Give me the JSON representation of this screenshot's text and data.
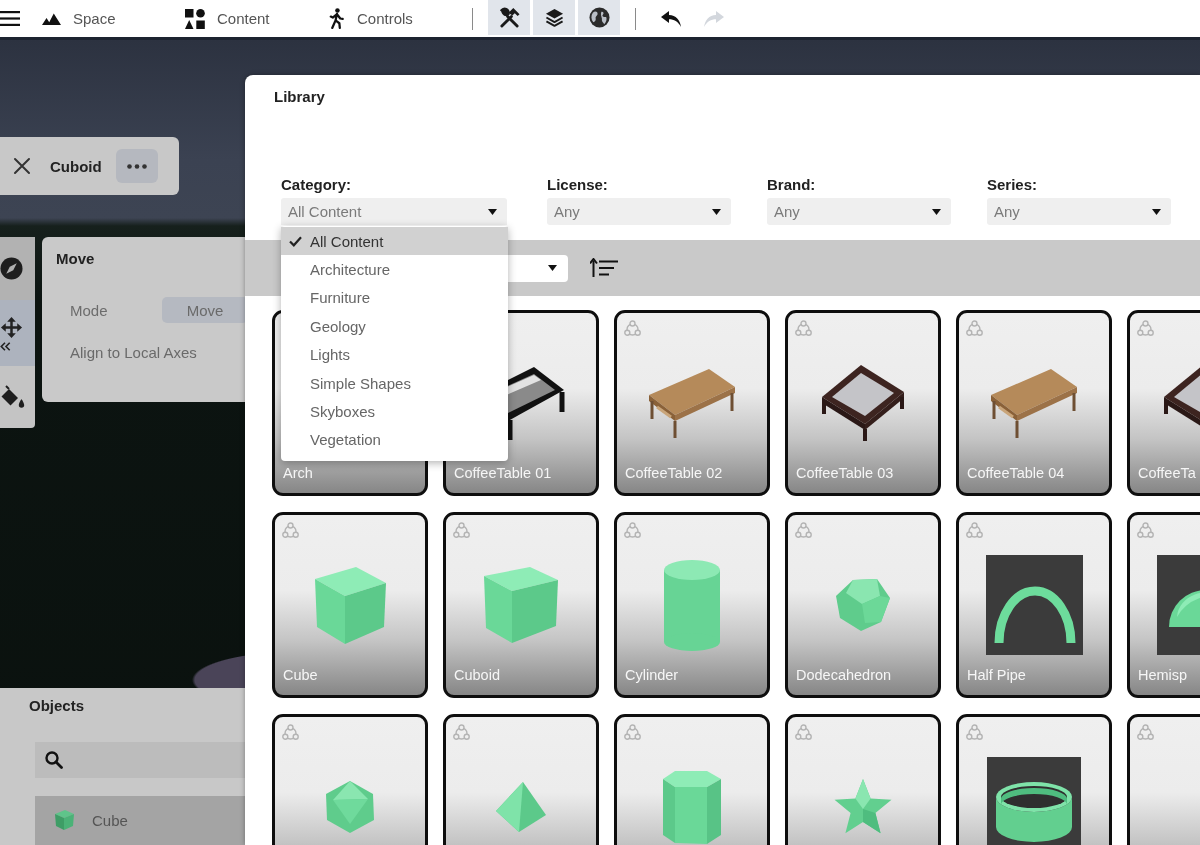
{
  "toolbar": {
    "tabs": [
      {
        "label": "Space"
      },
      {
        "label": "Content"
      },
      {
        "label": "Controls"
      }
    ],
    "view_toggles": [
      {
        "on": true
      },
      {
        "on": true
      },
      {
        "on": true
      }
    ],
    "history": [
      {
        "disabled": false
      },
      {
        "disabled": true
      }
    ]
  },
  "selection_panel": {
    "title": "Cuboid"
  },
  "tool_rail": [
    {
      "selected": false
    },
    {
      "selected": true
    },
    {
      "selected": false
    }
  ],
  "move_panel": {
    "title": "Move",
    "mode_label": "Mode",
    "mode_value": "Move",
    "option_label": "Align to Local Axes"
  },
  "objects_panel": {
    "title": "Objects",
    "items": [
      {
        "name": "Cube",
        "selected": true
      }
    ]
  },
  "library": {
    "title": "Library",
    "filters": [
      {
        "label": "Category:",
        "value": "All Content",
        "expanded": true,
        "options": [
          {
            "label": "All Content",
            "selected": true
          },
          {
            "label": "Architecture",
            "selected": false
          },
          {
            "label": "Furniture",
            "selected": false
          },
          {
            "label": "Geology",
            "selected": false
          },
          {
            "label": "Lights",
            "selected": false
          },
          {
            "label": "Simple Shapes",
            "selected": false
          },
          {
            "label": "Skyboxes",
            "selected": false
          },
          {
            "label": "Vegetation",
            "selected": false
          }
        ]
      },
      {
        "label": "License:",
        "value": "Any"
      },
      {
        "label": "Brand:",
        "value": "Any"
      },
      {
        "label": "Series:",
        "value": "Any"
      }
    ],
    "items": [
      {
        "name": "Arch"
      },
      {
        "name": "CoffeeTable 01",
        "kind": "glasstable"
      },
      {
        "name": "CoffeeTable 02",
        "kind": "woodtable",
        "badge": true
      },
      {
        "name": "CoffeeTable 03",
        "kind": "darktable",
        "badge": true
      },
      {
        "name": "CoffeeTable 04",
        "kind": "woodtable",
        "badge": true
      },
      {
        "name": "CoffeeTa",
        "kind": "darktable",
        "badge": true
      },
      {
        "name": "Cube",
        "kind": "cube",
        "badge": true
      },
      {
        "name": "Cuboid",
        "kind": "cuboid",
        "badge": true
      },
      {
        "name": "Cylinder",
        "kind": "cylinder",
        "badge": true
      },
      {
        "name": "Dodecahedron",
        "kind": "dodecahedron",
        "badge": true
      },
      {
        "name": "Half Pipe",
        "kind": "halfpipe",
        "badge": true
      },
      {
        "name": "Hemisp",
        "kind": "hemisphere",
        "badge": true
      },
      {
        "kind": "icosahedron",
        "badge": true
      },
      {
        "kind": "tetrahedron",
        "badge": true
      },
      {
        "kind": "prism",
        "badge": true
      },
      {
        "kind": "star",
        "badge": true
      },
      {
        "kind": "ring",
        "badge": true
      },
      {
        "badge": true
      }
    ]
  }
}
